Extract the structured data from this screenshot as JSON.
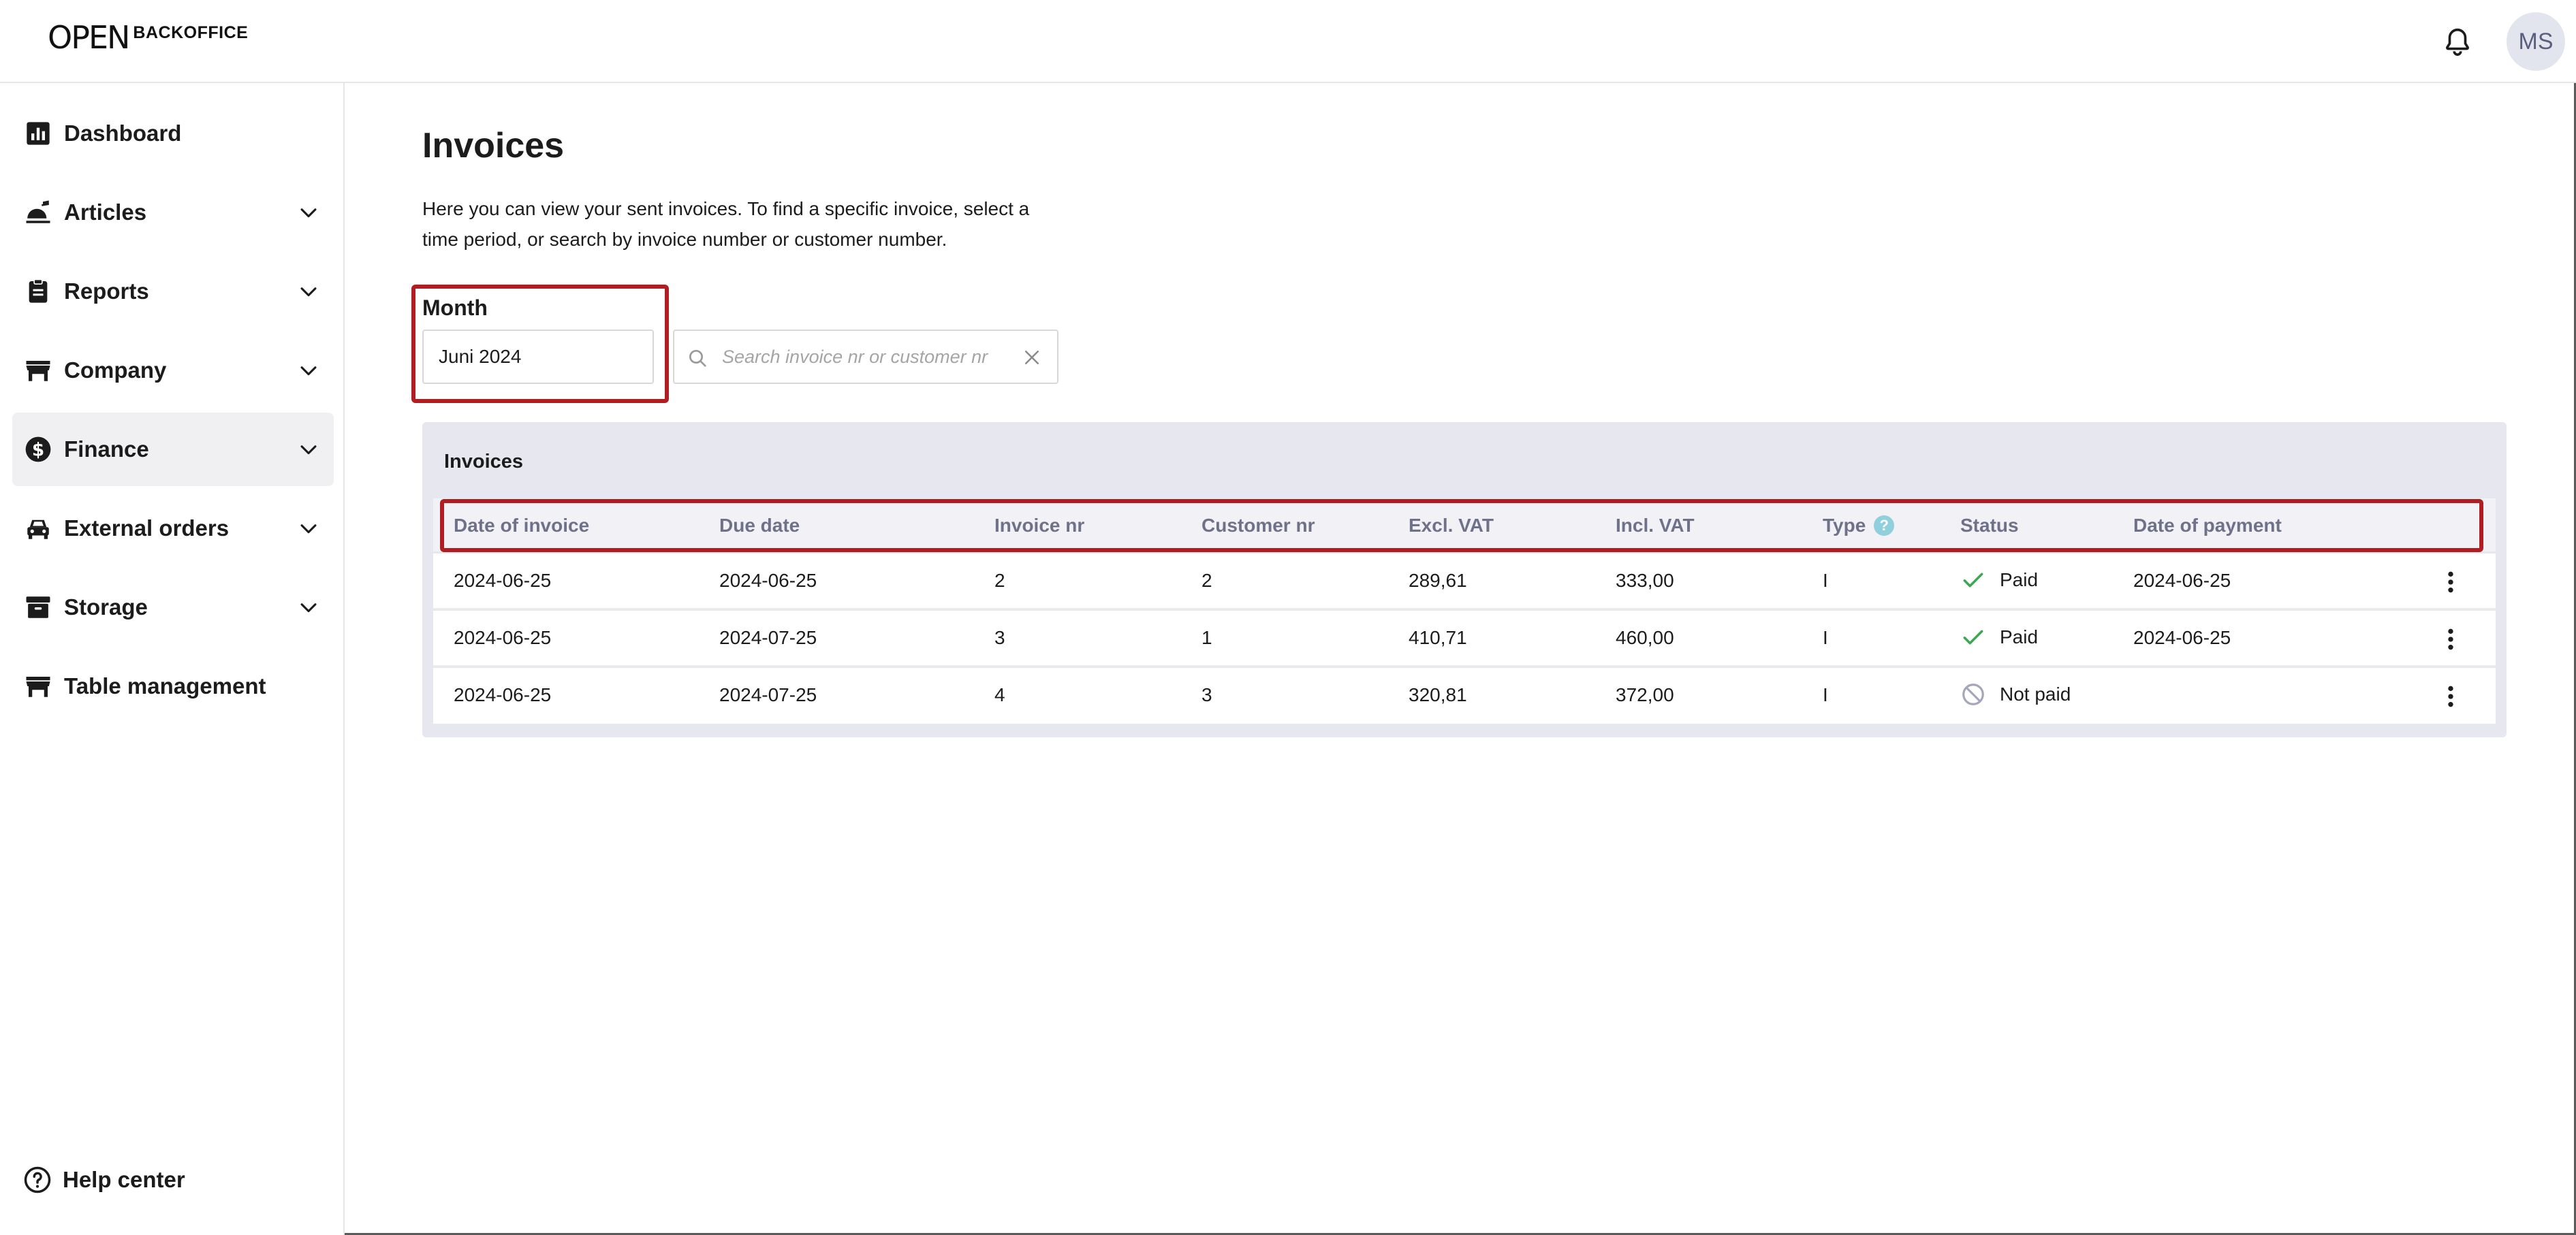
{
  "header": {
    "logo_mark": "OPEN",
    "logo_text": "BACKOFFICE",
    "avatar_initials": "MS"
  },
  "sidebar": {
    "items": [
      {
        "label": "Dashboard",
        "icon": "bar-chart-icon",
        "expandable": false
      },
      {
        "label": "Articles",
        "icon": "food-icon",
        "expandable": true
      },
      {
        "label": "Reports",
        "icon": "clipboard-icon",
        "expandable": true
      },
      {
        "label": "Company",
        "icon": "store-icon",
        "expandable": true
      },
      {
        "label": "Finance",
        "icon": "dollar-icon",
        "expandable": true,
        "active": true
      },
      {
        "label": "External orders",
        "icon": "car-icon",
        "expandable": true
      },
      {
        "label": "Storage",
        "icon": "archive-icon",
        "expandable": true
      },
      {
        "label": "Table management",
        "icon": "table-icon",
        "expandable": false
      }
    ],
    "help_label": "Help center"
  },
  "main": {
    "title": "Invoices",
    "description": "Here you can view your sent invoices. To find a specific invoice, select a time period, or search by invoice number or customer number.",
    "month_label": "Month",
    "month_value": "Juni 2024",
    "search_placeholder": "Search invoice nr or customer nr"
  },
  "table": {
    "title": "Invoices",
    "columns": [
      "Date of invoice",
      "Due date",
      "Invoice nr",
      "Customer nr",
      "Excl. VAT",
      "Incl. VAT",
      "Type",
      "Status",
      "Date of payment"
    ],
    "type_help": "?",
    "rows": [
      {
        "date": "2024-06-25",
        "due": "2024-06-25",
        "invoice_nr": "2",
        "customer_nr": "2",
        "excl": "289,61",
        "incl": "333,00",
        "type": "I",
        "status": "Paid",
        "payment_date": "2024-06-25"
      },
      {
        "date": "2024-06-25",
        "due": "2024-07-25",
        "invoice_nr": "3",
        "customer_nr": "1",
        "excl": "410,71",
        "incl": "460,00",
        "type": "I",
        "status": "Paid",
        "payment_date": "2024-06-25"
      },
      {
        "date": "2024-06-25",
        "due": "2024-07-25",
        "invoice_nr": "4",
        "customer_nr": "3",
        "excl": "320,81",
        "incl": "372,00",
        "type": "I",
        "status": "Not paid",
        "payment_date": ""
      }
    ]
  },
  "colors": {
    "highlight": "#b01e23",
    "paid": "#3aa850",
    "not_paid": "#a4a7bb",
    "header_text": "#6e7288"
  }
}
